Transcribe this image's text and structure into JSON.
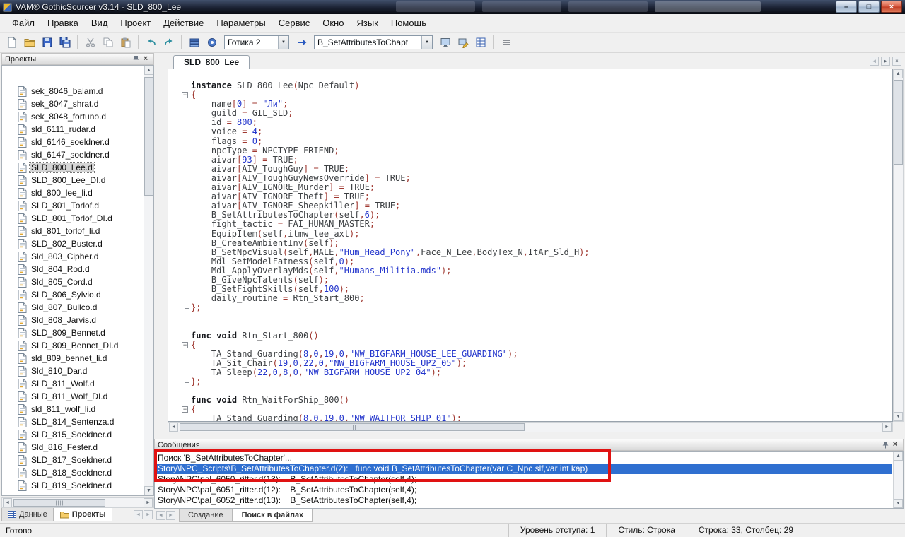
{
  "window": {
    "title": "VAM® GothicSourcer v3.14 - SLD_800_Lee"
  },
  "glyphs": {
    "minimize": "–",
    "maximize": "□",
    "close": "×",
    "arrow_left": "◄",
    "arrow_right": "►",
    "arrow_up": "▲",
    "arrow_down": "▼",
    "dropdown": "▼"
  },
  "menubar": {
    "items": [
      "Файл",
      "Правка",
      "Вид",
      "Проект",
      "Действие",
      "Параметры",
      "Сервис",
      "Окно",
      "Язык",
      "Помощь"
    ]
  },
  "toolbar": {
    "gothic_combo_value": "Готика 2",
    "symbol_combo_value": "B_SetAttributesToChapt"
  },
  "projects_panel": {
    "title": "Проекты",
    "selected_file": "SLD_800_Lee.d",
    "files": [
      "sek_8046_balam.d",
      "sek_8047_shrat.d",
      "sek_8048_fortuno.d",
      "sld_6111_rudar.d",
      "sld_6146_soeldner.d",
      "sld_6147_soeldner.d",
      "SLD_800_Lee.d",
      "SLD_800_Lee_DI.d",
      "sld_800_lee_li.d",
      "SLD_801_Torlof.d",
      "SLD_801_Torlof_DI.d",
      "sld_801_torlof_li.d",
      "SLD_802_Buster.d",
      "Sld_803_Cipher.d",
      "Sld_804_Rod.d",
      "Sld_805_Cord.d",
      "SLD_806_Sylvio.d",
      "Sld_807_Bullco.d",
      "Sld_808_Jarvis.d",
      "SLD_809_Bennet.d",
      "SLD_809_Bennet_DI.d",
      "sld_809_bennet_li.d",
      "Sld_810_Dar.d",
      "SLD_811_Wolf.d",
      "SLD_811_Wolf_DI.d",
      "sld_811_wolf_li.d",
      "SLD_814_Sentenza.d",
      "SLD_815_Soeldner.d",
      "Sld_816_Fester.d",
      "SLD_817_Soeldner.d",
      "SLD_818_Soeldner.d",
      "SLD_819_Soeldner.d"
    ],
    "bottom_tabs": [
      {
        "label": "Данные",
        "icon": "grid",
        "active": false
      },
      {
        "label": "Проекты",
        "icon": "folder",
        "active": true
      }
    ]
  },
  "editor": {
    "tab_label": "SLD_800_Lee",
    "code_lines": [
      {
        "t": "instance SLD_800_Lee(Npc_Default)",
        "f": ""
      },
      {
        "t": "{",
        "f": "start"
      },
      {
        "t": "    name[0] = \"Ли\";",
        "f": "mid"
      },
      {
        "t": "    guild = GIL_SLD;",
        "f": "mid"
      },
      {
        "t": "    id = 800;",
        "f": "mid"
      },
      {
        "t": "    voice = 4;",
        "f": "mid"
      },
      {
        "t": "    flags = 0;",
        "f": "mid"
      },
      {
        "t": "    npcType = NPCTYPE_FRIEND;",
        "f": "mid"
      },
      {
        "t": "    aivar[93] = TRUE;",
        "f": "mid"
      },
      {
        "t": "    aivar[AIV_ToughGuy] = TRUE;",
        "f": "mid"
      },
      {
        "t": "    aivar[AIV_ToughGuyNewsOverride] = TRUE;",
        "f": "mid"
      },
      {
        "t": "    aivar[AIV_IGNORE_Murder] = TRUE;",
        "f": "mid"
      },
      {
        "t": "    aivar[AIV_IGNORE_Theft] = TRUE;",
        "f": "mid"
      },
      {
        "t": "    aivar[AIV_IGNORE_Sheepkiller] = TRUE;",
        "f": "mid"
      },
      {
        "t": "    B_SetAttributesToChapter(self,6);",
        "f": "mid"
      },
      {
        "t": "    fight_tactic = FAI_HUMAN_MASTER;",
        "f": "mid"
      },
      {
        "t": "    EquipItem(self,itmw_lee_axt);",
        "f": "mid"
      },
      {
        "t": "    B_CreateAmbientInv(self);",
        "f": "mid"
      },
      {
        "t": "    B_SetNpcVisual(self,MALE,\"Hum_Head_Pony\",Face_N_Lee,BodyTex_N,ItAr_Sld_H);",
        "f": "mid"
      },
      {
        "t": "    Mdl_SetModelFatness(self,0);",
        "f": "mid"
      },
      {
        "t": "    Mdl_ApplyOverlayMds(self,\"Humans_Militia.mds\");",
        "f": "mid"
      },
      {
        "t": "    B_GiveNpcTalents(self);",
        "f": "mid"
      },
      {
        "t": "    B_SetFightSkills(self,100);",
        "f": "mid"
      },
      {
        "t": "    daily_routine = Rtn_Start_800;",
        "f": "mid"
      },
      {
        "t": "};",
        "f": "end"
      },
      {
        "t": "",
        "f": ""
      },
      {
        "t": "",
        "f": ""
      },
      {
        "t": "func void Rtn_Start_800()",
        "f": ""
      },
      {
        "t": "{",
        "f": "start"
      },
      {
        "t": "    TA_Stand_Guarding(8,0,19,0,\"NW_BIGFARM_HOUSE_LEE_GUARDING\");",
        "f": "mid"
      },
      {
        "t": "    TA_Sit_Chair(19,0,22,0,\"NW_BIGFARM_HOUSE_UP2_05\");",
        "f": "mid"
      },
      {
        "t": "    TA_Sleep(22,0,8,0,\"NW_BIGFARM_HOUSE_UP2_04\");",
        "f": "mid"
      },
      {
        "t": "};",
        "f": "end"
      },
      {
        "t": "",
        "f": ""
      },
      {
        "t": "func void Rtn_WaitForShip_800()",
        "f": ""
      },
      {
        "t": "{",
        "f": "start"
      },
      {
        "t": "    TA_Stand_Guarding(8,0,19,0,\"NW_WAITFOR_SHIP_01\");",
        "f": "mid"
      }
    ]
  },
  "messages_panel": {
    "title": "Сообщения",
    "rows": [
      {
        "text": "Поиск 'B_SetAttributesToChapter'...",
        "selected": false
      },
      {
        "text": "Story\\NPC_Scripts\\B_SetAttributesToChapter.d(2):   func void B_SetAttributesToChapter(var C_Npc slf,var int kap)",
        "selected": true
      },
      {
        "text": "Story\\NPC\\pal_6050_ritter.d(13):    B_SetAttributesToChapter(self,4);",
        "selected": false
      },
      {
        "text": "Story\\NPC\\pal_6051_ritter.d(12):    B_SetAttributesToChapter(self,4);",
        "selected": false
      },
      {
        "text": "Story\\NPC\\pal_6052_ritter.d(13):    B_SetAttributesToChapter(self,4);",
        "selected": false
      }
    ],
    "tabs": [
      {
        "label": "Создание",
        "active": false
      },
      {
        "label": "Поиск в файлах",
        "active": true
      }
    ]
  },
  "statusbar": {
    "ready": "Готово",
    "indent_level": "Уровень отступа: 1",
    "style": "Стиль: Строка",
    "cursor": "Строка: 33, Столбец: 29"
  },
  "colors": {
    "annotation_red": "#e01212",
    "selection_blue": "#2f6fd0",
    "titlebar_dark": "#141a26"
  }
}
